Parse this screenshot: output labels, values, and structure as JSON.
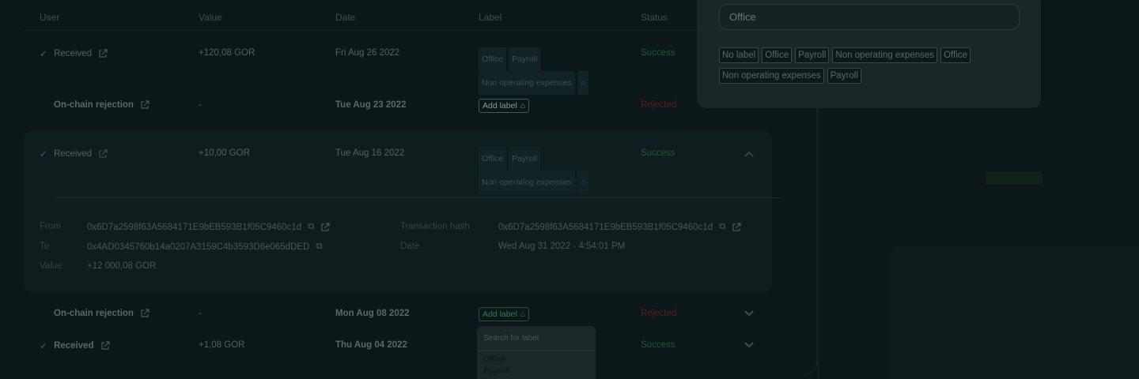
{
  "table": {
    "headers": {
      "user": "User",
      "value": "Value",
      "date": "Date",
      "label": "Label",
      "status": "Status"
    },
    "rows": [
      {
        "user": "Received",
        "value": "+120,08 GOR",
        "date": "Fri Aug 26 2022",
        "labels": [
          "Office",
          "Payroll",
          "Non operating expenses"
        ],
        "status": "Success"
      },
      {
        "user": "On-chain rejection",
        "value": "-",
        "date": "Tue Aug 23 2022",
        "add_label": "Add label",
        "status": "Rejected"
      },
      {
        "user": "Received",
        "value": "+10,00 GOR",
        "date": "Tue Aug 16 2022",
        "labels": [
          "Office",
          "Payroll",
          "Non operating expenses"
        ],
        "status": "Success"
      },
      {
        "user": "On-chain rejection",
        "value": "-",
        "date": "Mon Aug 08 2022",
        "add_label": "Add label",
        "status": "Rejected"
      },
      {
        "user": "Received",
        "value": "+1,08 GOR",
        "date": "Thu Aug 04 2022",
        "status": "Success"
      }
    ]
  },
  "details": {
    "from_label": "From",
    "from_value": "0x6D7a2598f63A5684171E9bEB593B1f05C9460c1d",
    "to_label": "To",
    "to_value": "0x4AD0345760b14a0207A3159C4b3593D6e065dDED",
    "value_label": "Value",
    "value_value": "+12 000,08 GOR",
    "hash_label": "Transaction hash",
    "hash_value": "0x6D7a2598f63A5684171E9bEB593B1f05C9460c1d",
    "date_label": "Date",
    "date_value": "Wed Aug 31 2022 - 4:54:01 PM"
  },
  "label_popover": {
    "input_value": "Office",
    "chips": [
      "No label",
      "Office",
      "Payroll",
      "Non operating expenses",
      "Office",
      "Non operating expenses",
      "Payroll"
    ]
  },
  "dropdown": {
    "placeholder": "Search for label",
    "options": [
      "Office",
      "Payroll"
    ]
  },
  "colors": {
    "success": "#1a5c35",
    "rejected": "#5a1f20",
    "accent_green": "#2d7f4a"
  },
  "icons": [
    "check-icon",
    "external-link-icon",
    "tag-icon",
    "copy-icon",
    "chevron-up-icon",
    "chevron-down-icon"
  ]
}
